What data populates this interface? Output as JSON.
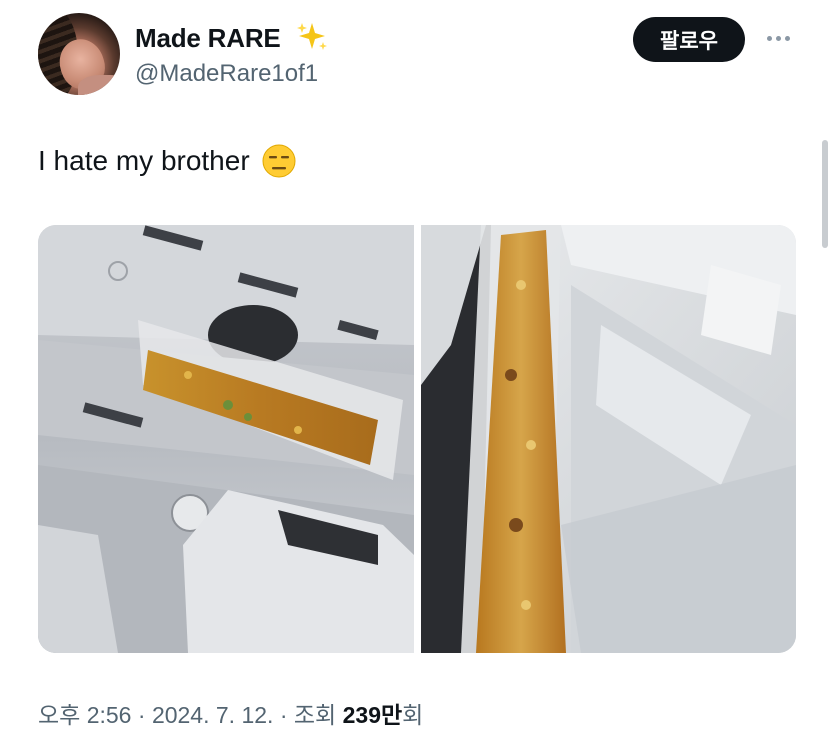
{
  "author": {
    "display_name": "Made RARE",
    "name_emoji": "sparkles-emoji",
    "handle": "@MadeRare1of1",
    "avatar": "profile-photo"
  },
  "header": {
    "follow_label": "팔로우",
    "more_icon": "more-horizontal-icon"
  },
  "tweet": {
    "text": "I hate my brother",
    "text_emoji": "expressionless-face-emoji"
  },
  "media": {
    "photos": [
      {
        "description_icon": "fridge-shelf-rice-container-photo"
      },
      {
        "description_icon": "rice-container-closeup-photo"
      }
    ]
  },
  "meta": {
    "time": "오후 2:56",
    "date": "2024. 7. 12.",
    "views_prefix": "조회",
    "views_value": "239만",
    "views_suffix": "회",
    "separator": "·"
  },
  "colors": {
    "text_primary": "#0f1419",
    "text_secondary": "#536471",
    "follow_bg": "#0f1419",
    "follow_text": "#ffffff"
  }
}
